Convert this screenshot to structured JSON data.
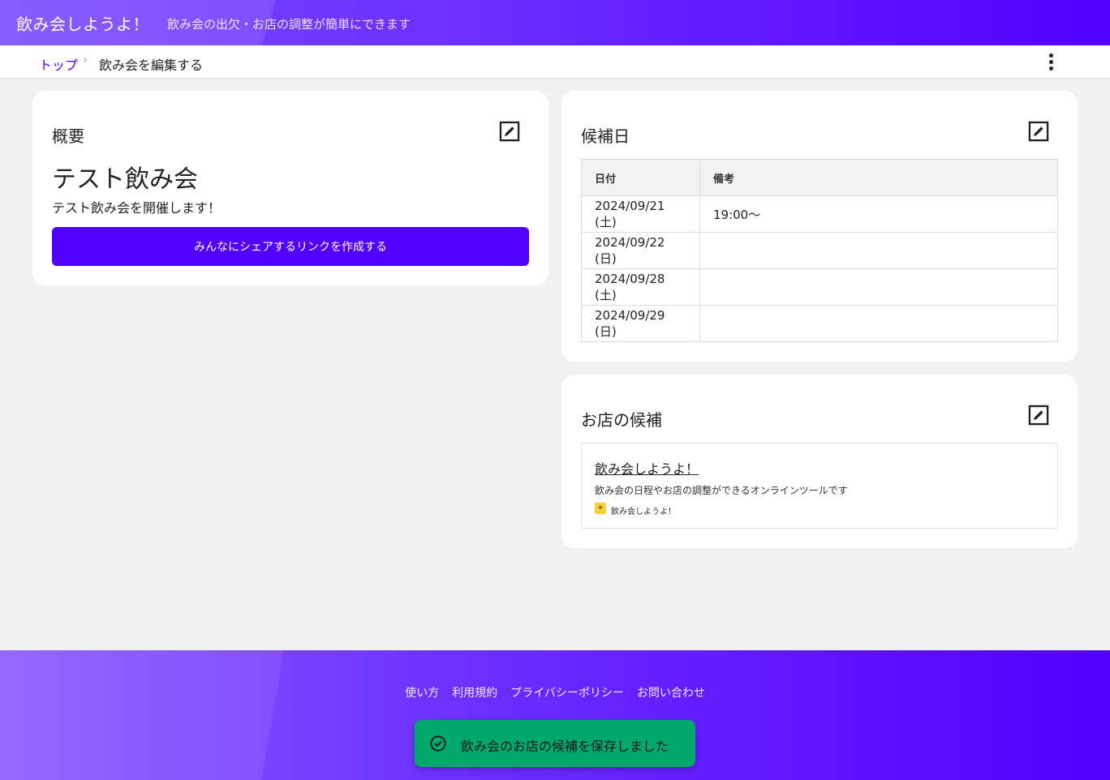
{
  "header": {
    "title": "飲み会しようよ！",
    "tagline": "飲み会の出欠・お店の調整が簡単にできます"
  },
  "breadcrumb": {
    "top_label": "トップ",
    "separator": "›",
    "current_label": "飲み会を編集する"
  },
  "overview": {
    "heading": "概要",
    "event_name": "テスト飲み会",
    "event_description": "テスト飲み会を開催します！",
    "share_button_label": "みんなにシェアするリンクを作成する"
  },
  "candidate_dates": {
    "heading": "候補日",
    "columns": [
      "日付",
      "備考"
    ],
    "rows": [
      {
        "date": "2024/09/21 (土)",
        "note": "19:00～"
      },
      {
        "date": "2024/09/22 (日)",
        "note": ""
      },
      {
        "date": "2024/09/28 (土)",
        "note": ""
      },
      {
        "date": "2024/09/29 (日)",
        "note": ""
      }
    ]
  },
  "shop_candidates": {
    "heading": "お店の候補",
    "items": [
      {
        "title": "飲み会しようよ！",
        "description": "飲み会の日程やお店の調整ができるオンラインツールです",
        "site_name": "飲み会しようよ！"
      }
    ]
  },
  "footer": {
    "links": [
      "使い方",
      "利用規約",
      "プライバシーポリシー",
      "お問い合わせ"
    ]
  },
  "toast": {
    "message": "飲み会のお店の候補を保存しました"
  },
  "colors": {
    "accent": "#5200ff",
    "toast": "#00a86b"
  }
}
